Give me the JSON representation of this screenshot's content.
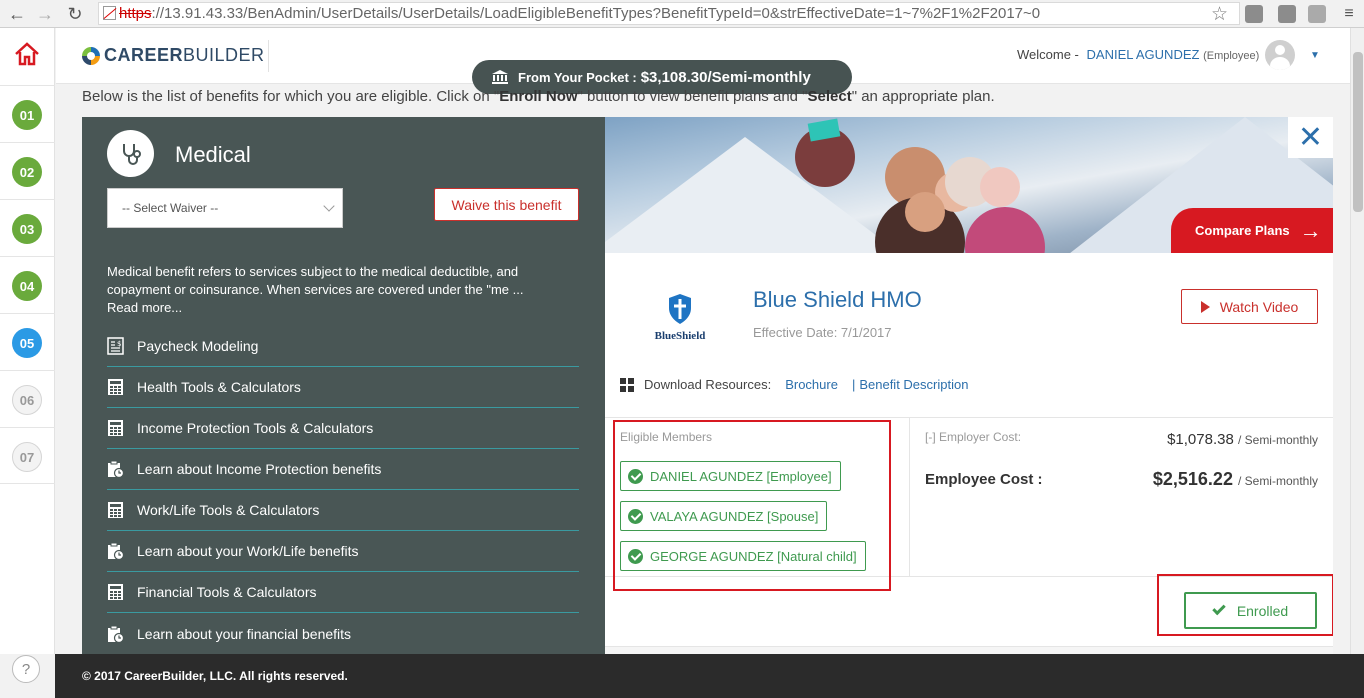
{
  "browser": {
    "url_scheme": "https",
    "url_rest": "://13.91.43.33/BenAdmin/UserDetails/UserDetails/LoadEligibleBenefitTypes?BenefitTypeId=0&strEffectiveDate=1~7%2F1%2F2017~0"
  },
  "steps": [
    "01",
    "02",
    "03",
    "04",
    "05",
    "06",
    "07"
  ],
  "help_label": "?",
  "header": {
    "logo_bold": "CAREER",
    "logo_light": "BUILDER",
    "welcome": "Welcome -",
    "user_name": "DANIEL AGUNDEZ",
    "user_role": "(Employee)"
  },
  "pocket": {
    "label": "From Your Pocket :",
    "amount": "$3,108.30/Semi-monthly"
  },
  "intro": {
    "part1": "Below is the list of benefits for which you are eligible. Click on \"",
    "enroll": "Enroll Now",
    "part2": "\" button to view benefit plans and \"",
    "select": "Select",
    "part3": "\" an appropriate plan."
  },
  "benefit": {
    "title": "Medical",
    "waiver_placeholder": "-- Select Waiver --",
    "waive_button": "Waive this benefit",
    "description": "Medical benefit refers to services subject to the medical deductible, and copayment or coinsurance. When services are covered under the \"me ...",
    "read_more": "Read more...",
    "tools": [
      "Paycheck Modeling",
      "Health Tools & Calculators",
      "Income Protection Tools & Calculators",
      "Learn about Income Protection benefits",
      "Work/Life Tools & Calculators",
      "Learn about your Work/Life benefits",
      "Financial Tools & Calculators",
      "Learn about your financial benefits"
    ]
  },
  "plan": {
    "close": "✕",
    "compare": "Compare Plans",
    "carrier_logo": "BlueShield",
    "name": "Blue Shield HMO",
    "effective": "Effective Date: 7/1/2017",
    "watch_video": "Watch Video",
    "download_label": "Download Resources:",
    "brochure": "Brochure",
    "benefit_description": "Benefit Description",
    "members_label": "Eligible Members",
    "members": [
      "DANIEL AGUNDEZ [Employee]",
      "VALAYA AGUNDEZ [Spouse]",
      "GEORGE AGUNDEZ [Natural child]"
    ],
    "employer_cost_label": "[-] Employer Cost:",
    "employer_cost": "$1,078.38",
    "employee_cost_label": "Employee Cost :",
    "employee_cost": "$2,516.22",
    "period": "/ Semi-monthly",
    "enrolled": "Enrolled"
  },
  "footer": "© 2017 CareerBuilder, LLC. All rights reserved.",
  "colors": {
    "panel": "#495655",
    "accent_red": "#d71921",
    "link_blue": "#2c6fab",
    "green": "#3f9a4f"
  }
}
